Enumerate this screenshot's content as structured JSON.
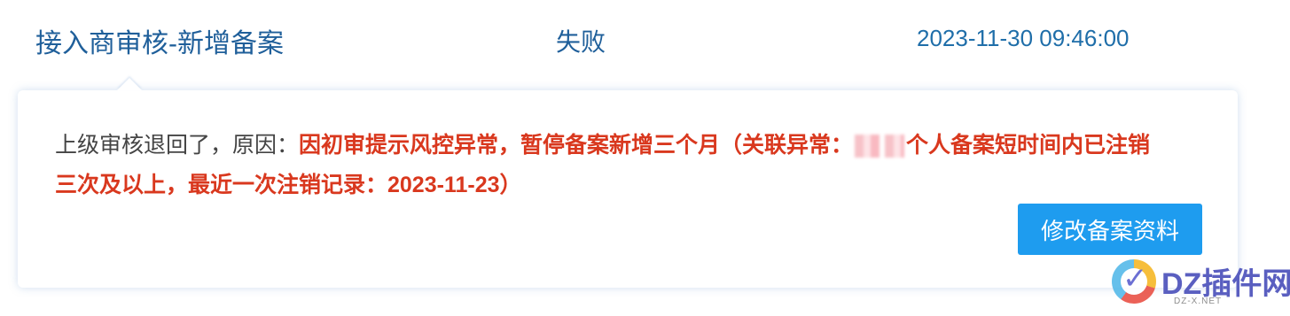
{
  "record": {
    "title": "接入商审核-新增备案",
    "status": "失败",
    "datetime": "2023-11-30 09:46:00"
  },
  "detail": {
    "message_prefix": "上级审核退回了，原因：",
    "reason_part1": "因初审提示风控异常，暂停备案新增三个月（关联异常：",
    "reason_part2": "个人备案短时间内已注销三次及以上，最近一次注销记录：2023-11-23）",
    "button_label": "修改备案资料"
  },
  "watermark": {
    "text": "DZ插件网",
    "subtext": "DZ-X.NET",
    "icon": "check-circle-logo-icon"
  },
  "colors": {
    "link_blue": "#1f5f9a",
    "reason_red": "#d9381e",
    "button_blue": "#1e9cef"
  }
}
